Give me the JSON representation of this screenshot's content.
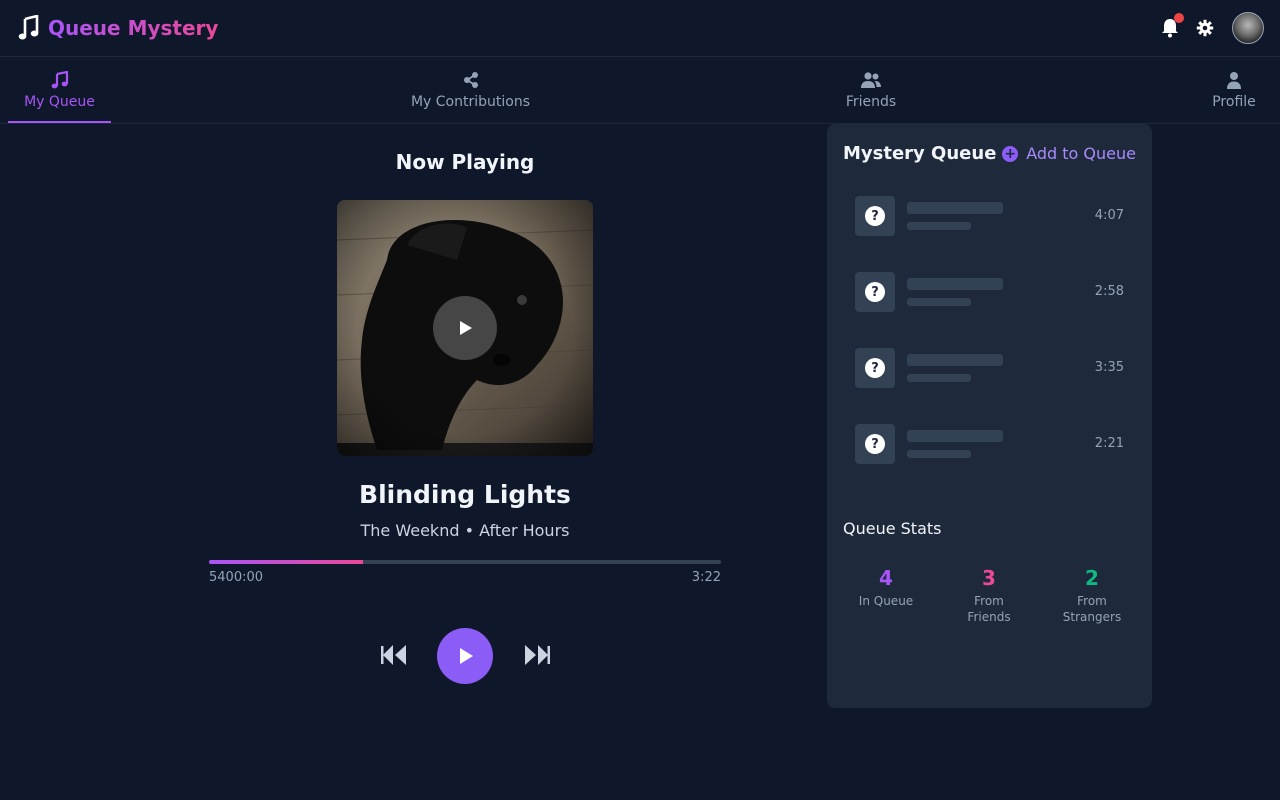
{
  "header": {
    "title": "Queue Mystery",
    "logo_icon": "music-note-icon",
    "notification_icon": "bell-icon",
    "settings_icon": "gear-icon"
  },
  "tabs": [
    {
      "label": "My Queue",
      "icon": "music-note-icon",
      "active": true
    },
    {
      "label": "My Contributions",
      "icon": "share-icon",
      "active": false
    },
    {
      "label": "Friends",
      "icon": "users-icon",
      "active": false
    },
    {
      "label": "Profile",
      "icon": "user-icon",
      "active": false
    }
  ],
  "now_playing": {
    "heading": "Now Playing",
    "title": "Blinding Lights",
    "subtitle": "The Weeknd • After Hours",
    "current_time": "5400:00",
    "total_time": "3:22",
    "progress": 0.3
  },
  "queue": {
    "title": "Mystery Queue",
    "add_label": "Add to Queue",
    "items": [
      {
        "mystery_mark": "?",
        "duration": "4:07"
      },
      {
        "mystery_mark": "?",
        "duration": "2:58"
      },
      {
        "mystery_mark": "?",
        "duration": "3:35"
      },
      {
        "mystery_mark": "?",
        "duration": "2:21"
      }
    ]
  },
  "stats": {
    "title": "Queue Stats",
    "items": [
      {
        "value": "4",
        "label": "In Queue",
        "color": "#a855f7"
      },
      {
        "value": "3",
        "label": "From Friends",
        "color": "#ec4899"
      },
      {
        "value": "2",
        "label": "From Strangers",
        "color": "#10b981"
      }
    ]
  },
  "colors": {
    "accent": "#8b5cf6",
    "background": "#0f172a",
    "panel": "#1e293b"
  }
}
